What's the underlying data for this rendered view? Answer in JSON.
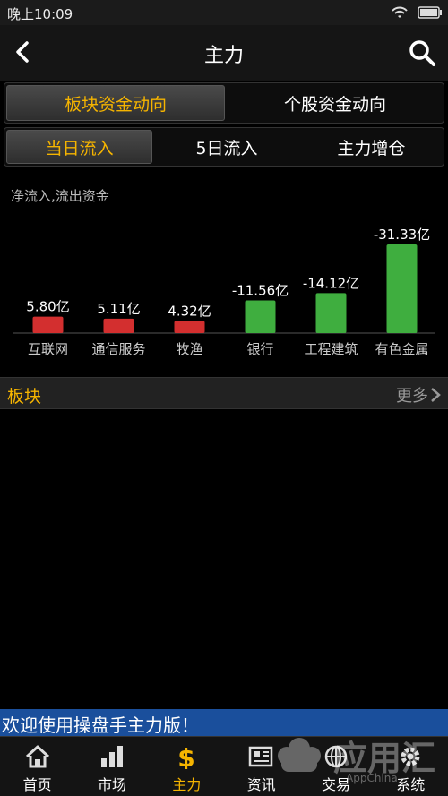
{
  "status": {
    "time": "晚上10:09"
  },
  "header": {
    "title": "主力",
    "back_icon": "back-arrow-icon",
    "search_icon": "search-icon"
  },
  "tabs_primary": [
    {
      "label": "板块资金动向",
      "active": true
    },
    {
      "label": "个股资金动向",
      "active": false
    }
  ],
  "tabs_secondary": [
    {
      "label": "当日流入",
      "active": true
    },
    {
      "label": "5日流入",
      "active": false
    },
    {
      "label": "主力增仓",
      "active": false
    }
  ],
  "chart_label": "净流入,流出资金",
  "chart_data": {
    "type": "bar",
    "categories": [
      "互联网",
      "通信服务",
      "牧渔",
      "银行",
      "工程建筑",
      "有色金属"
    ],
    "values": [
      5.8,
      5.11,
      4.32,
      -11.56,
      -14.12,
      -31.33
    ],
    "data_labels": [
      "5.80亿",
      "5.11亿",
      "4.32亿",
      "-11.56亿",
      "-14.12亿",
      "-31.33亿"
    ],
    "unit": "亿",
    "colors": {
      "inflow": "#d32f2f",
      "outflow": "#3fae3f"
    }
  },
  "sector_section": {
    "title": "板块",
    "more": "更多"
  },
  "marquee": "欢迎使用操盘手主力版！",
  "tabbar": [
    {
      "label": "首页",
      "icon": "home-icon",
      "active": false
    },
    {
      "label": "市场",
      "icon": "market-chart-icon",
      "active": false
    },
    {
      "label": "主力",
      "icon": "dollar-icon",
      "active": true
    },
    {
      "label": "资讯",
      "icon": "news-icon",
      "active": false
    },
    {
      "label": "交易",
      "icon": "trade-globe-icon",
      "active": false
    },
    {
      "label": "系统",
      "icon": "settings-icon",
      "active": false
    }
  ],
  "watermark": {
    "text": "应用汇",
    "sub": "AppChina"
  },
  "colors": {
    "accent": "#f5b400",
    "marquee_bg": "#1a4f9c"
  }
}
